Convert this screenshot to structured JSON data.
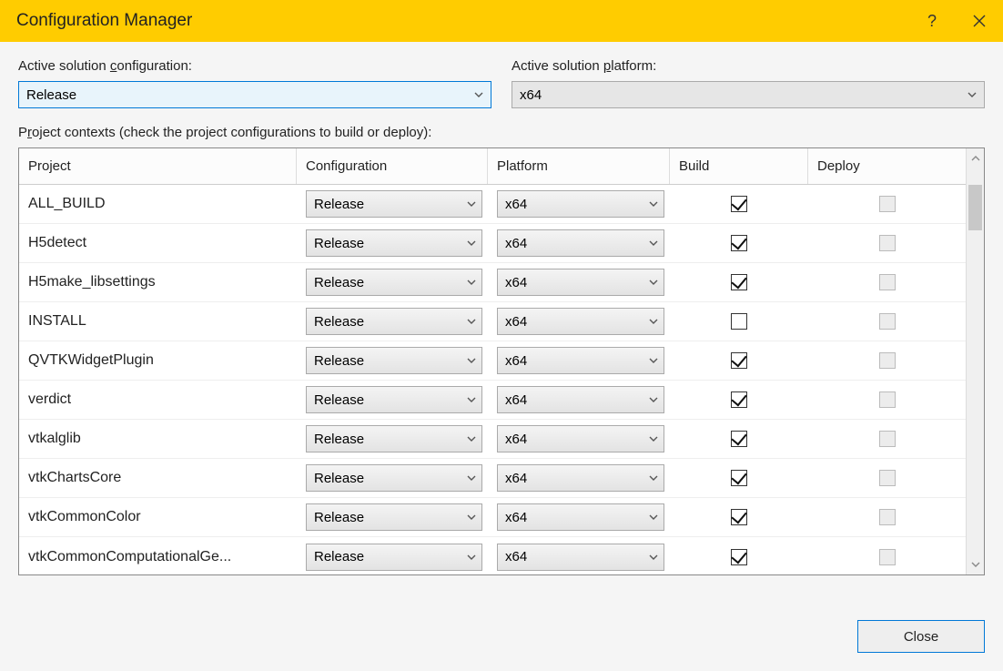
{
  "window": {
    "title": "Configuration Manager",
    "help": "?",
    "close_label": "Close"
  },
  "top": {
    "config_label_pre": "Active solution ",
    "config_label_u": "c",
    "config_label_post": "onfiguration:",
    "config_value": "Release",
    "platform_label_pre": "Active solution ",
    "platform_label_u": "p",
    "platform_label_post": "latform:",
    "platform_value": "x64"
  },
  "section": {
    "label_pre": "P",
    "label_u": "r",
    "label_post": "oject contexts (check the project configurations to build or deploy):"
  },
  "headers": {
    "project": "Project",
    "configuration": "Configuration",
    "platform": "Platform",
    "build": "Build",
    "deploy": "Deploy"
  },
  "rows": [
    {
      "project": "ALL_BUILD",
      "config": "Release",
      "platform": "x64",
      "build": true,
      "deploy_disabled": true
    },
    {
      "project": "H5detect",
      "config": "Release",
      "platform": "x64",
      "build": true,
      "deploy_disabled": true
    },
    {
      "project": "H5make_libsettings",
      "config": "Release",
      "platform": "x64",
      "build": true,
      "deploy_disabled": true
    },
    {
      "project": "INSTALL",
      "config": "Release",
      "platform": "x64",
      "build": false,
      "deploy_disabled": true
    },
    {
      "project": "QVTKWidgetPlugin",
      "config": "Release",
      "platform": "x64",
      "build": true,
      "deploy_disabled": true
    },
    {
      "project": "verdict",
      "config": "Release",
      "platform": "x64",
      "build": true,
      "deploy_disabled": true
    },
    {
      "project": "vtkalglib",
      "config": "Release",
      "platform": "x64",
      "build": true,
      "deploy_disabled": true
    },
    {
      "project": "vtkChartsCore",
      "config": "Release",
      "platform": "x64",
      "build": true,
      "deploy_disabled": true
    },
    {
      "project": "vtkCommonColor",
      "config": "Release",
      "platform": "x64",
      "build": true,
      "deploy_disabled": true
    },
    {
      "project": "vtkCommonComputationalGe...",
      "config": "Release",
      "platform": "x64",
      "build": true,
      "deploy_disabled": true
    }
  ]
}
